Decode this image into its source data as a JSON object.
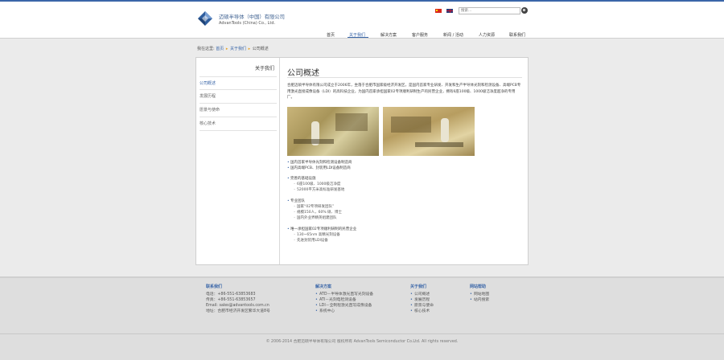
{
  "header": {
    "logo_cn": "迈硕半导体（中国）有限公司",
    "logo_en": "AdvanTools (China) Co., Ltd.",
    "search_placeholder": "搜索...",
    "nav": [
      "首页",
      "关于我们",
      "解决方案",
      "客户服务",
      "新闻 / 活动",
      "人力资源",
      "联系我们"
    ],
    "nav_active": "关于我们"
  },
  "breadcrumb": {
    "prefix": "我在这里:",
    "home": "首页",
    "section": "关于我们",
    "current": "公司概述"
  },
  "sidebar": {
    "title": "关于我们",
    "items": [
      "公司概述",
      "发展历程",
      "愿景与使命",
      "核心技术"
    ]
  },
  "main": {
    "title": "公司概述",
    "intro": "合肥迈硕半导体有限公司成立于2006年，坐落于合肥市国家级经济开发区，是国内首家专业研发、开发和生产半导体光刻和检测设备、高端PCB专用激光直接成像设备（LDI）的高科技企业，为国内首家承担国家02专项顺利研制生产的民营企业，拥有6座100级、1000级洁净度超净的专用厂。",
    "bullets": {
      "b1": "国内首家半导体光刻和检测设备制造商",
      "b2": "国内高端PCB、封装用LDI设备制造商",
      "b3": "完善的基础设施",
      "b3a": "6座100级、1000级洁净度",
      "b3b": "52000平方米高标准研发基地",
      "b4": "专业团队",
      "b4a": "国家“02专项研发团队”",
      "b4b": "规模150人，60% 硕、博士",
      "b4c": "国内外业界精英组建团队",
      "b5": "唯一承担国家02专项顺利研制的民营企业",
      "b5a": "130~65nm 高精光刻设备",
      "b5b": "先进封装用LDI设备"
    }
  },
  "footer": {
    "contact": {
      "title": "联系我们",
      "phone": "电话：+86-551-63853683",
      "fax": "传真：+86-551-63853657",
      "email": "Email: sales@advantools.com.cn",
      "address": "地址：合肥市经济开发区繁华大道8号"
    },
    "solutions": {
      "title": "解决方案",
      "items": [
        "ATD－半导体激光直写光刻设备",
        "ATI－光刻电检测设备",
        "LDI－全制程激光直写成像设备",
        "系统中心"
      ]
    },
    "about": {
      "title": "关于我们",
      "items": [
        "公司概述",
        "发展历程",
        "愿景与使命",
        "核心技术"
      ]
    },
    "site": {
      "title": "网站帮助",
      "items": [
        "网站地图",
        "站内搜索"
      ]
    },
    "copyright": "© 2006-2014 合肥迈硕半导体有限公司 版权所有 AdvanTools Semiconductor Co.Ltd. All rights reserved."
  },
  "colors": {
    "brand": "#3a66a8",
    "bullet_accent": "#e8a020",
    "footer_bg": "#dedede"
  },
  "icons": [
    "logo-diamond-icon",
    "flag-cn-icon",
    "flag-uk-icon",
    "search-icon"
  ]
}
